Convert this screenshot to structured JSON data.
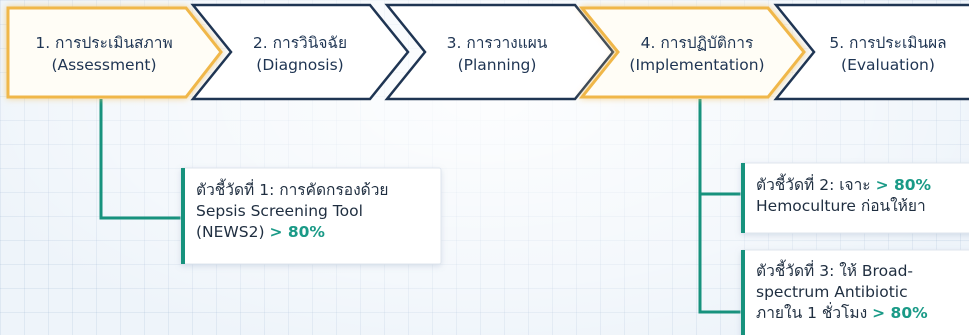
{
  "steps": [
    {
      "title": "1. การประเมินสภาพ",
      "subtitle": "(Assessment)",
      "highlighted": true
    },
    {
      "title": "2. การวินิจฉัย",
      "subtitle": "(Diagnosis)",
      "highlighted": false
    },
    {
      "title": "3. การวางแผน",
      "subtitle": "(Planning)",
      "highlighted": false
    },
    {
      "title": "4. การปฏิบัติการ",
      "subtitle": "(Implementation)",
      "highlighted": true
    },
    {
      "title": "5. การประเมินผล",
      "subtitle": "(Evaluation)",
      "highlighted": false
    }
  ],
  "indicators": [
    {
      "line1": "ตัวชี้วัดที่ 1: การคัดกรองด้วย",
      "line2": "Sepsis Screening Tool",
      "line3_prefix": "(NEWS2)",
      "target": "> 80%"
    },
    {
      "line1_prefix": "ตัวชี้วัดที่ 2: เจาะ",
      "target": "> 80%",
      "line2": "Hemoculture ก่อนให้ยา"
    },
    {
      "line1": "ตัวชี้วัดที่ 3: ให้ Broad-",
      "line2": "spectrum Antibiotic",
      "line3_prefix": "ภายใน 1 ชั่วโมง",
      "target": "> 80%"
    }
  ],
  "colors": {
    "highlight": "#f0b74a",
    "outline": "#1f3553",
    "connector": "#17927d",
    "accent_text": "#1a9a87"
  }
}
